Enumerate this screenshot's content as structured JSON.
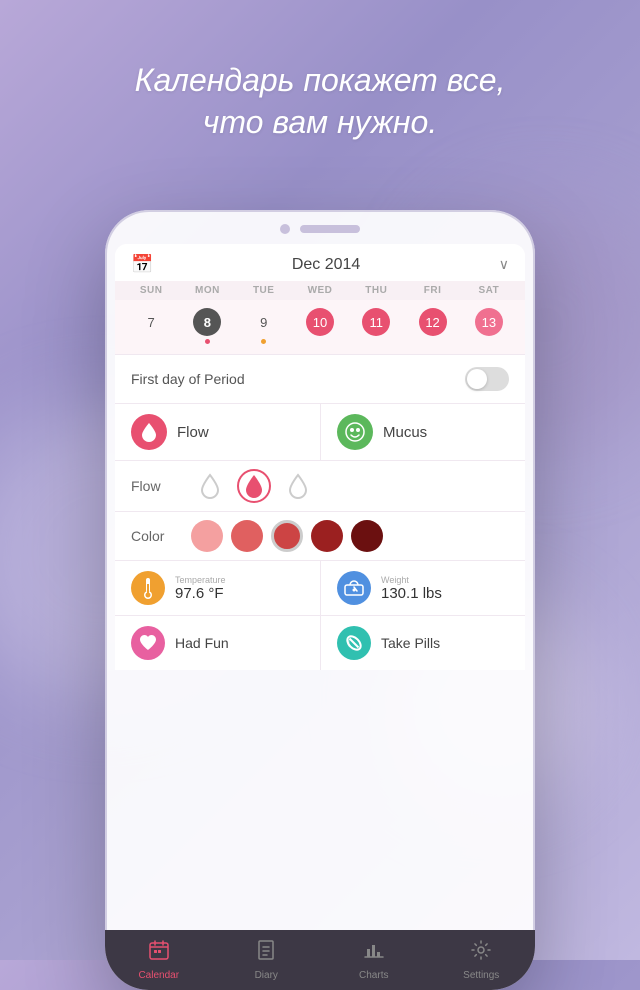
{
  "hero": {
    "text_line1": "Календарь покажет все,",
    "text_line2": "что вам нужно."
  },
  "calendar": {
    "month": "Dec 2014",
    "icon_label": "calendar-icon",
    "chevron": "∨",
    "day_headers": [
      "SUN",
      "MON",
      "TUE",
      "WED",
      "THU",
      "FRI",
      "SAT"
    ],
    "days": [
      {
        "num": "7",
        "style": "normal",
        "dot": false
      },
      {
        "num": "8",
        "style": "highlighted",
        "dot": true,
        "dot_color": "red"
      },
      {
        "num": "9",
        "style": "normal",
        "dot": true,
        "dot_color": "orange"
      },
      {
        "num": "10",
        "style": "period-red",
        "dot": false
      },
      {
        "num": "11",
        "style": "period-red",
        "dot": false
      },
      {
        "num": "12",
        "style": "period-red",
        "dot": false
      },
      {
        "num": "13",
        "style": "period-pink",
        "dot": false
      }
    ]
  },
  "period_toggle": {
    "label": "First day of Period",
    "enabled": false
  },
  "features": {
    "flow_label": "Flow",
    "mucus_label": "Mucus",
    "flow_icon": "💧",
    "mucus_icon": "🌿"
  },
  "flow_selector": {
    "label": "Flow",
    "options": [
      "light",
      "medium",
      "heavy"
    ]
  },
  "color_selector": {
    "label": "Color",
    "colors": [
      "#f4a0a0",
      "#e06060",
      "#cc4444",
      "#9b2020",
      "#6b1010"
    ],
    "selected_index": 2
  },
  "stats": {
    "temperature": {
      "label": "Temperature",
      "value": "97.6 °F",
      "icon": "🌡"
    },
    "weight": {
      "label": "Weight",
      "value": "130.1 lbs",
      "icon": "⚖"
    }
  },
  "actions": {
    "had_fun": {
      "label": "Had Fun",
      "icon": "♥"
    },
    "take_pills": {
      "label": "Take Pills",
      "icon": "💊"
    }
  },
  "tabs": {
    "items": [
      {
        "label": "Calendar",
        "icon": "📅",
        "active": true
      },
      {
        "label": "Diary",
        "icon": "📖",
        "active": false
      },
      {
        "label": "Charts",
        "icon": "📊",
        "active": false
      },
      {
        "label": "Settings",
        "icon": "⚙",
        "active": false
      }
    ]
  }
}
